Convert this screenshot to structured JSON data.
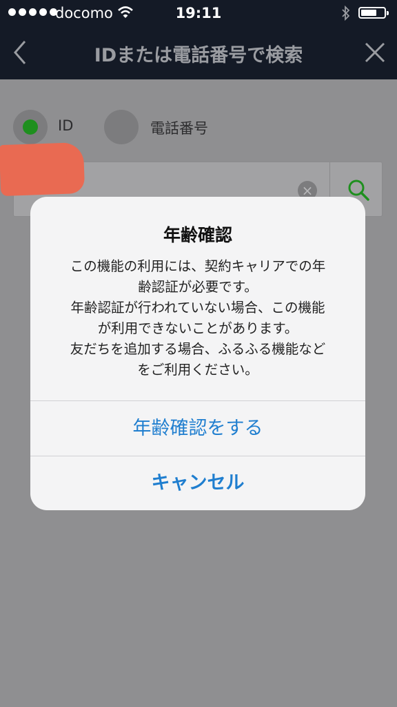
{
  "status_bar": {
    "carrier": "docomo",
    "time": "19:11",
    "icons": [
      "signal-dots-icon",
      "wifi-icon",
      "bluetooth-icon",
      "battery-icon"
    ]
  },
  "nav": {
    "title": "IDまたは電話番号で検索",
    "back_icon": "chevron-left-icon",
    "close_icon": "close-icon"
  },
  "search_mode": {
    "options": [
      {
        "label": "ID",
        "selected": true
      },
      {
        "label": "電話番号",
        "selected": false
      }
    ],
    "accent_color": "#1e8f1e"
  },
  "search": {
    "clear_icon": "clear-icon",
    "search_icon": "search-icon"
  },
  "dialog": {
    "title": "年齢確認",
    "message_lines": [
      "この機能の利用には、契約キャリアでの年",
      "齢認証が必要です。",
      "年齢認証が行われていない場合、この機能",
      "が利用できないことがあります。",
      "友だちを追加する場合、ふるふる機能など",
      "をご利用ください。"
    ],
    "confirm_label": "年齢確認をする",
    "cancel_label": "キャンセル",
    "button_color": "#1f7ecf"
  }
}
